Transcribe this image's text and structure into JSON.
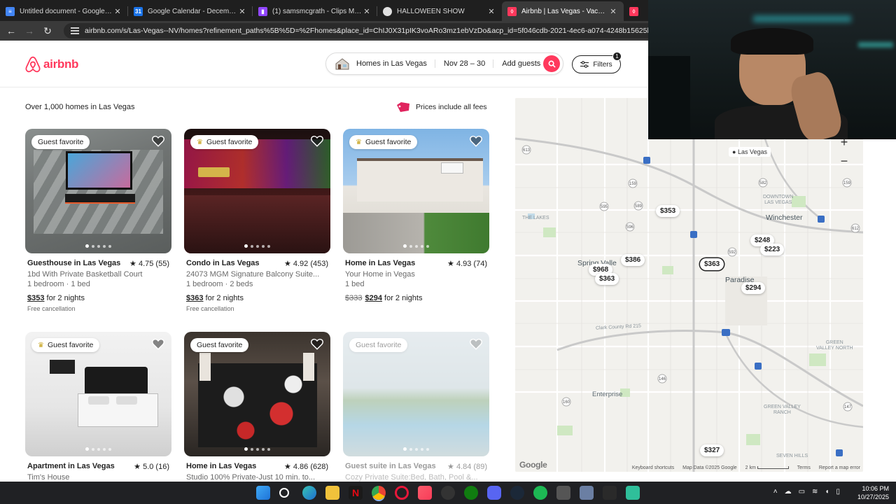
{
  "browser": {
    "tabs": [
      {
        "title": "Untitled document - Google Do",
        "color": "#4285f4",
        "active": false
      },
      {
        "title": "Google Calendar - December 2",
        "color": "#1a73e8",
        "active": false
      },
      {
        "title": "(1) samsmcgrath - Clips Manag",
        "color": "#9146ff",
        "active": false
      },
      {
        "title": "HALLOWEEN SHOW",
        "color": "#e0e0e0",
        "active": false
      },
      {
        "title": "Airbnb | Las Vegas - Vacation R",
        "color": "#ff385c",
        "active": true
      },
      {
        "title": "1",
        "color": "#ff385c",
        "active": false
      }
    ],
    "url": "airbnb.com/s/Las-Vegas--NV/homes?refinement_paths%5B%5D=%2Fhomes&place_id=ChIJ0X31pIK3voARo3mz1ebVzDo&acp_id=5f046cdb-2021-4ec6-a074-4248b15625b5&"
  },
  "header": {
    "logo_text": "airbnb",
    "search": {
      "location": "Homes in Las Vegas",
      "dates": "Nov 28 – 30",
      "guests": "Add guests"
    },
    "filters_label": "Filters",
    "filters_count": "1",
    "brand_color": "#ff385c"
  },
  "results": {
    "count_text": "Over 1,000 homes in Las Vegas",
    "fees_note": "Prices include all fees"
  },
  "listings": [
    {
      "badge": "Guest favorite",
      "trophy": false,
      "title": "Guesthouse in Las Vegas",
      "rating": "★ 4.75 (55)",
      "subtitle": "1bd With Private Basketball Court",
      "beds": "1 bedroom · 1 bed",
      "old_price": "",
      "price": "$353",
      "price_suffix": " for 2 nights",
      "note": "Free cancellation"
    },
    {
      "badge": "Guest favorite",
      "trophy": true,
      "title": "Condo in Las Vegas",
      "rating": "★ 4.92 (453)",
      "subtitle": "24073 MGM Signature Balcony Suite...",
      "beds": "1 bedroom · 2 beds",
      "old_price": "",
      "price": "$363",
      "price_suffix": " for 2 nights",
      "note": "Free cancellation"
    },
    {
      "badge": "Guest favorite",
      "trophy": true,
      "title": "Home in Las Vegas",
      "rating": "★ 4.93 (74)",
      "subtitle": "Your Home in Vegas",
      "beds": "1 bed",
      "old_price": "$333",
      "price": "$294",
      "price_suffix": " for 2 nights",
      "note": ""
    },
    {
      "badge": "Guest favorite",
      "trophy": true,
      "title": "Apartment in Las Vegas",
      "rating": "★ 5.0 (16)",
      "subtitle": "Tim's House"
    },
    {
      "badge": "Guest favorite",
      "trophy": false,
      "title": "Home in Las Vegas",
      "rating": "★ 4.86 (628)",
      "subtitle": "Studio 100% Private-Just 10 min. to..."
    },
    {
      "badge": "Guest favorite",
      "trophy": false,
      "title": "Guest suite in Las Vegas",
      "rating": "★ 4.84 (89)",
      "subtitle": "Cozy Private Suite:Bed, Bath, Pool &..."
    }
  ],
  "map": {
    "pins": [
      "$353",
      "$386",
      "$968",
      "$363",
      "$363",
      "$248",
      "$223",
      "$294",
      "$327"
    ],
    "labels": {
      "las_vegas": "Las Vegas",
      "winchester": "Winchester",
      "paradise": "Paradise",
      "spring_valley": "Spring Valle",
      "enterprise": "Enterprise",
      "downtown": "DOWNTOWN\nLAS VEGAS",
      "the_lakes": "THE LAKES",
      "green_valley_north": "GREEN\nVALLEY NORTH",
      "green_valley_ranch": "GREEN VALLEY\nRANCH",
      "seven_hills": "SEVEN HILLS",
      "clark_county": "Clark County Rd 215"
    },
    "footer": {
      "shortcuts": "Keyboard shortcuts",
      "data": "Map Data ©2025 Google",
      "scale": "2 km",
      "terms": "Terms",
      "report": "Report a map error"
    },
    "google": "Google"
  },
  "taskbar": {
    "time": "10:06 PM",
    "date": "10/27/2025"
  }
}
